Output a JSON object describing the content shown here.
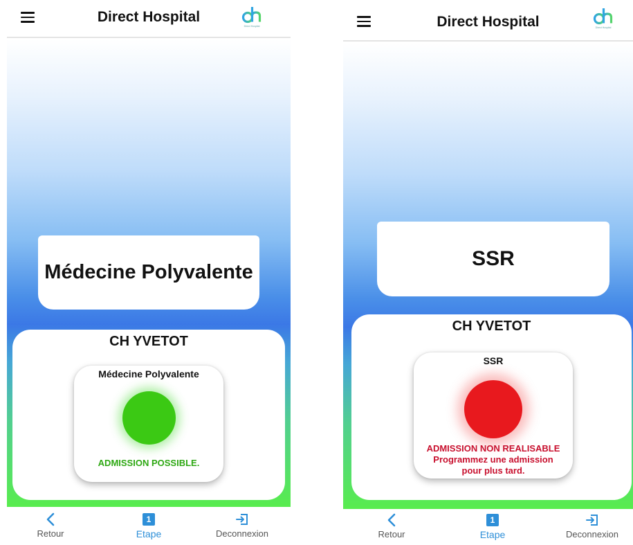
{
  "colors": {
    "accent": "#2e8fd8",
    "possible": "#2ea813",
    "impossible": "#c8102e",
    "indicator_green": "#3bc914",
    "indicator_red": "#e8191e"
  },
  "screens": [
    {
      "app_title": "Direct Hospital",
      "logo": {
        "mark": "dh",
        "text": "Direct Hospital"
      },
      "specialty": "Médecine Polyvalente",
      "hospital": "CH YVETOT",
      "status": {
        "title": "Médecine Polyvalente",
        "state": "available",
        "indicator": "green",
        "message": [
          "ADMISSION POSSIBLE."
        ]
      },
      "nav": {
        "back": "Retour",
        "step": "Etape",
        "step_number": "1",
        "logout": "Deconnexion"
      }
    },
    {
      "app_title": "Direct Hospital",
      "logo": {
        "mark": "dh",
        "text": "Direct Hospital"
      },
      "specialty": "SSR",
      "hospital": "CH YVETOT",
      "status": {
        "title": "SSR",
        "state": "unavailable",
        "indicator": "red",
        "message": [
          "ADMISSION NON REALISABLE",
          "Programmez une admission",
          "pour plus tard."
        ]
      },
      "nav": {
        "back": "Retour",
        "step": "Etape",
        "step_number": "1",
        "logout": "Deconnexion"
      }
    }
  ]
}
